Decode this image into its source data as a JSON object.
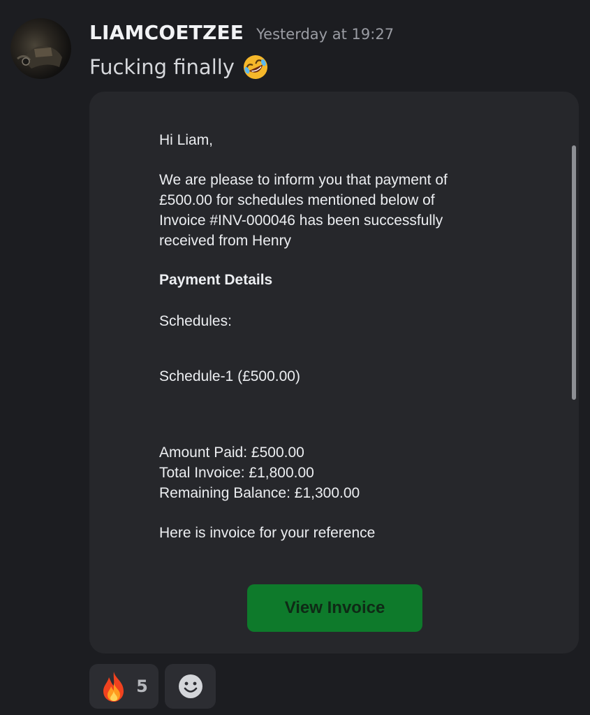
{
  "message": {
    "username": "LIAMCOETZEE",
    "timestamp": "Yesterday at 19:27",
    "text": "Fucking finally",
    "emoji": "rolling-on-floor-laughing-icon"
  },
  "embed": {
    "greeting": "Hi Liam,",
    "body_lines": [
      "We are please to inform you that payment of",
      "£500.00 for schedules mentioned below of",
      "Invoice #INV-000046 has been successfully",
      "received from Henry"
    ],
    "payment_details_heading": "Payment Details",
    "schedules_label": "Schedules:",
    "schedule_item": "Schedule-1 (£500.00)",
    "amount_paid": "Amount Paid: £500.00",
    "total_invoice": "Total Invoice: £1,800.00",
    "remaining_balance": "Remaining Balance: £1,300.00",
    "reference_note": "Here is invoice for your reference",
    "button_label": "View Invoice",
    "button_color": "#0e7a2b"
  },
  "reactions": [
    {
      "emoji": "fire-icon",
      "count": "5"
    },
    {
      "emoji": "add-reaction-icon"
    }
  ],
  "colors": {
    "background": "#1c1d21",
    "embed_background": "#26272b",
    "username": "#f2f3f5",
    "timestamp": "#9a9ca3"
  }
}
